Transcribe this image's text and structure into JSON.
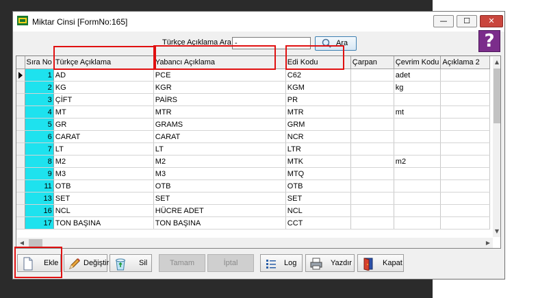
{
  "window": {
    "title": "Miktar Cinsi [FormNo:165]",
    "min_glyph": "—",
    "max_glyph": "☐",
    "close_glyph": "✕"
  },
  "search": {
    "label": "Türkçe Açıklama Ara",
    "value": "-",
    "button_label": "Ara"
  },
  "help": {
    "glyph": "?"
  },
  "grid": {
    "columns": [
      "Sıra No",
      "Türkçe Açıklama",
      "Yabancı Açıklama",
      "Edi Kodu",
      "Çarpan",
      "Çevrim Kodu",
      "Açıklama 2"
    ],
    "rows": [
      {
        "no": "1",
        "tr": "AD",
        "yab": "PCE",
        "edi": "C62",
        "carpan": "",
        "cevrim": "adet",
        "aciklama2": ""
      },
      {
        "no": "2",
        "tr": "KG",
        "yab": "KGR",
        "edi": "KGM",
        "carpan": "",
        "cevrim": "kg",
        "aciklama2": ""
      },
      {
        "no": "3",
        "tr": "ÇİFT",
        "yab": "PAİRS",
        "edi": "PR",
        "carpan": "",
        "cevrim": "",
        "aciklama2": ""
      },
      {
        "no": "4",
        "tr": "MT",
        "yab": "MTR",
        "edi": "MTR",
        "carpan": "",
        "cevrim": "mt",
        "aciklama2": ""
      },
      {
        "no": "5",
        "tr": "GR",
        "yab": "GRAMS",
        "edi": "GRM",
        "carpan": "",
        "cevrim": "",
        "aciklama2": ""
      },
      {
        "no": "6",
        "tr": "CARAT",
        "yab": "CARAT",
        "edi": "NCR",
        "carpan": "",
        "cevrim": "",
        "aciklama2": ""
      },
      {
        "no": "7",
        "tr": "LT",
        "yab": "LT",
        "edi": "LTR",
        "carpan": "",
        "cevrim": "",
        "aciklama2": ""
      },
      {
        "no": "8",
        "tr": "M2",
        "yab": "M2",
        "edi": "MTK",
        "carpan": "",
        "cevrim": "m2",
        "aciklama2": ""
      },
      {
        "no": "9",
        "tr": "M3",
        "yab": "M3",
        "edi": "MTQ",
        "carpan": "",
        "cevrim": "",
        "aciklama2": ""
      },
      {
        "no": "11",
        "tr": "OTB",
        "yab": "OTB",
        "edi": "OTB",
        "carpan": "",
        "cevrim": "",
        "aciklama2": ""
      },
      {
        "no": "13",
        "tr": "SET",
        "yab": "SET",
        "edi": "SET",
        "carpan": "",
        "cevrim": "",
        "aciklama2": ""
      },
      {
        "no": "16",
        "tr": "NCL",
        "yab": "HÜCRE ADET",
        "edi": "NCL",
        "carpan": "",
        "cevrim": "",
        "aciklama2": ""
      },
      {
        "no": "17",
        "tr": "TON BAŞINA",
        "yab": "TON BAŞINA",
        "edi": "CCT",
        "carpan": "",
        "cevrim": "",
        "aciklama2": ""
      }
    ],
    "scroll_up_glyph": "▲",
    "scroll_down_glyph": "▼",
    "scroll_left_glyph": "◀",
    "scroll_right_glyph": "▶"
  },
  "toolbar": {
    "ekle": "Ekle",
    "degistir": "Değiştir",
    "sil": "Sil",
    "tamam": "Tamam",
    "iptal": "İptal",
    "log": "Log",
    "yazdir": "Yazdır",
    "kapat": "Kapat"
  },
  "colors": {
    "row_number_bg": "#1ee2ee",
    "highlight": "#e01010",
    "help_bg": "#7b2d8b",
    "close_bg": "#c9463d"
  }
}
